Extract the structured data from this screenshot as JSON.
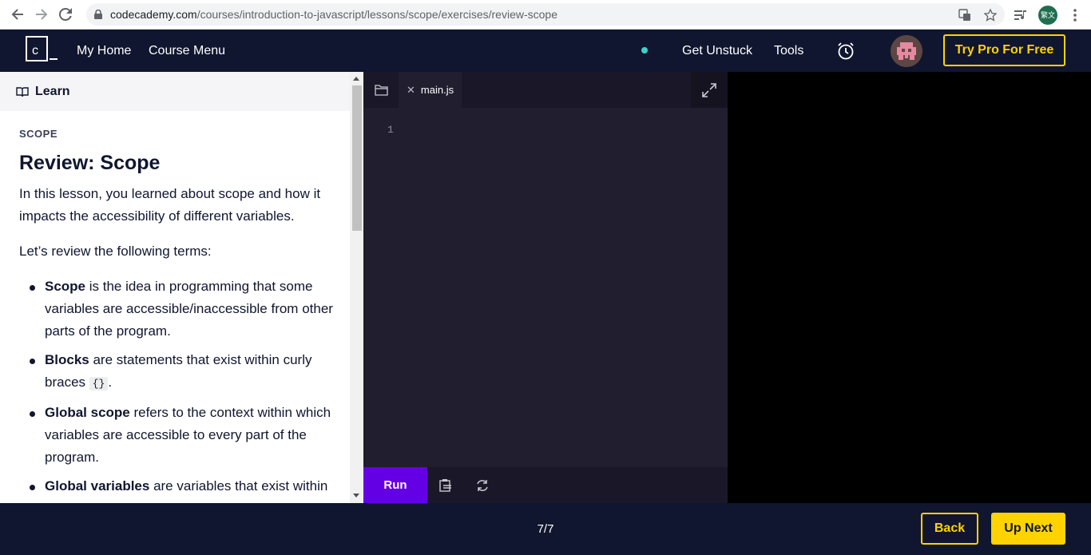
{
  "browser": {
    "url_host": "codecademy.com",
    "url_path": "/courses/introduction-to-javascript/lessons/scope/exercises/review-scope",
    "profile_label": "繁文"
  },
  "header": {
    "my_home": "My Home",
    "course_menu": "Course Menu",
    "get_unstuck": "Get Unstuck",
    "tools": "Tools",
    "try_pro": "Try Pro For Free"
  },
  "lesson": {
    "tab_label": "Learn",
    "kicker": "SCOPE",
    "title": "Review: Scope",
    "intro": "In this lesson, you learned about scope and how it impacts the accessibility of different variables.",
    "review_lead": "Let’s review the following terms:",
    "terms": [
      {
        "term": "Scope",
        "text": " is the idea in programming that some variables are accessible/inaccessible from other parts of the program."
      },
      {
        "term": "Blocks",
        "text": " are statements that exist within curly braces ",
        "code": "{}",
        "after": "."
      },
      {
        "term": "Global scope",
        "text": " refers to the context within which variables are accessible to every part of the program."
      },
      {
        "term": "Global variables",
        "text": " are variables that exist within"
      }
    ]
  },
  "editor": {
    "file_tab": "main.js",
    "line_number": "1",
    "run_label": "Run"
  },
  "footer": {
    "progress": "7/7",
    "back": "Back",
    "up_next": "Up Next"
  }
}
